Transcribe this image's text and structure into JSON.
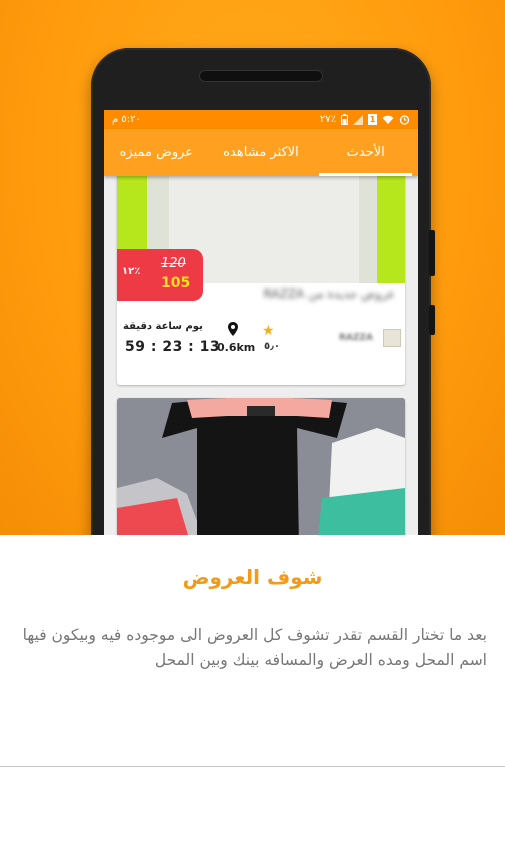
{
  "status_bar": {
    "time": "٥:٢٠ م",
    "battery": "٢٧٪"
  },
  "tabs": [
    {
      "label": "الأحدث",
      "active": true
    },
    {
      "label": "الاكثر مشاهده",
      "active": false
    },
    {
      "label": "عروض مميزه",
      "active": false
    }
  ],
  "offer_card": {
    "title": "عروض جديدة من RAZZA",
    "discount": "١٢٪",
    "old_price": "120",
    "new_price": "105",
    "timer_label": "يوم ساعة دقيقة",
    "timer": "59 : 23 : 13",
    "distance": "0.6km",
    "rating": "٥٫٠",
    "shop_name": "RAZZA"
  },
  "onboarding": {
    "title": "شوف العروض",
    "description": "بعد ما تختار القسم تقدر تشوف كل العروض الى موجوده فيه وبيكون فيها اسم المحل ومده العرض والمسافه بينك وبين المحل"
  },
  "colors": {
    "accent": "#ff9b0d",
    "tab_bar": "#ffa020",
    "badge": "#ee3a44",
    "title": "#f39a18"
  },
  "icons": [
    "location-pin-icon",
    "star-icon",
    "wifi-icon",
    "battery-icon",
    "sim-icon",
    "alarm-icon"
  ]
}
